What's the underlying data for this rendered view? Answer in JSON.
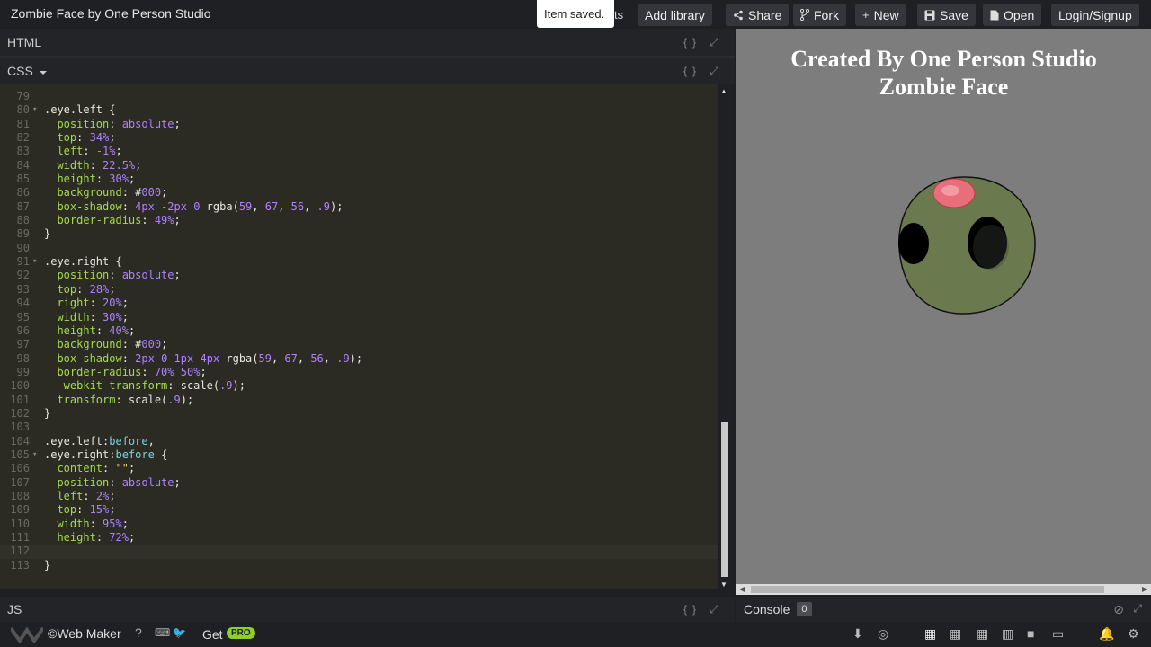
{
  "app": {
    "title": "Zombie Face by One Person Studio",
    "toast": "Item saved.",
    "toast_suffix": "ts"
  },
  "toolbar": {
    "add_library": "Add library",
    "share": "Share",
    "fork": "Fork",
    "new": "New",
    "save": "Save",
    "open": "Open",
    "login": "Login/Signup"
  },
  "panes": {
    "html": "HTML",
    "css": "CSS",
    "js": "JS",
    "tools": "{} ⤢"
  },
  "editor": {
    "lines": [
      {
        "n": "79",
        "code": ""
      },
      {
        "n": "80",
        "code": ".eye.left {"
      },
      {
        "n": "81",
        "code": "  position: absolute;"
      },
      {
        "n": "82",
        "code": "  top: 34%;"
      },
      {
        "n": "83",
        "code": "  left: -1%;"
      },
      {
        "n": "84",
        "code": "  width: 22.5%;"
      },
      {
        "n": "85",
        "code": "  height: 30%;"
      },
      {
        "n": "86",
        "code": "  background: #000;"
      },
      {
        "n": "87",
        "code": "  box-shadow: 4px -2px 0 rgba(59, 67, 56, .9);"
      },
      {
        "n": "88",
        "code": "  border-radius: 49%;"
      },
      {
        "n": "89",
        "code": "}"
      },
      {
        "n": "90",
        "code": ""
      },
      {
        "n": "91",
        "code": ".eye.right {"
      },
      {
        "n": "92",
        "code": "  position: absolute;"
      },
      {
        "n": "93",
        "code": "  top: 28%;"
      },
      {
        "n": "94",
        "code": "  right: 20%;"
      },
      {
        "n": "95",
        "code": "  width: 30%;"
      },
      {
        "n": "96",
        "code": "  height: 40%;"
      },
      {
        "n": "97",
        "code": "  background: #000;"
      },
      {
        "n": "98",
        "code": "  box-shadow: 2px 0 1px 4px rgba(59, 67, 56, .9);"
      },
      {
        "n": "99",
        "code": "  border-radius: 70% 50%;"
      },
      {
        "n": "100",
        "code": "  -webkit-transform: scale(.9);"
      },
      {
        "n": "101",
        "code": "  transform: scale(.9);"
      },
      {
        "n": "102",
        "code": "}"
      },
      {
        "n": "103",
        "code": ""
      },
      {
        "n": "104",
        "code": ".eye.left:before,"
      },
      {
        "n": "105",
        "code": ".eye.right:before {"
      },
      {
        "n": "106",
        "code": "  content: \"\";"
      },
      {
        "n": "107",
        "code": "  position: absolute;"
      },
      {
        "n": "108",
        "code": "  left: 2%;"
      },
      {
        "n": "109",
        "code": "  top: 15%;"
      },
      {
        "n": "110",
        "code": "  width: 95%;"
      },
      {
        "n": "111",
        "code": "  height: 72%;"
      },
      {
        "n": "112",
        "code": ""
      },
      {
        "n": "113",
        "code": "}"
      }
    ]
  },
  "preview": {
    "heading_line1": "Created By One Person Studio",
    "heading_line2": "Zombie Face",
    "face_color": "#6a7a4e",
    "brain_color": "#e86f7a"
  },
  "console": {
    "label": "Console",
    "count": "0"
  },
  "bottom": {
    "brand": "©Web Maker",
    "get": "Get",
    "pro": "PRO"
  }
}
